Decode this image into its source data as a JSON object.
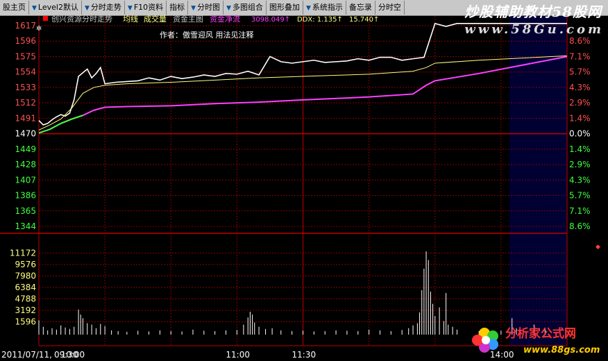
{
  "toolbar": {
    "items": [
      {
        "label": "股主页",
        "arrow": false
      },
      {
        "label": "Level2默认",
        "arrow": true
      },
      {
        "label": "分时走势",
        "arrow": true
      },
      {
        "label": "F10资料",
        "arrow": true
      },
      {
        "label": "指标",
        "arrow": false
      },
      {
        "label": "分时图",
        "arrow": true
      },
      {
        "label": "多图组合",
        "arrow": true
      },
      {
        "label": "图形叠加",
        "arrow": false
      },
      {
        "label": "系统指示",
        "arrow": true
      },
      {
        "label": "备忘录",
        "arrow": false
      },
      {
        "label": "分时空",
        "arrow": false
      }
    ]
  },
  "watermark": {
    "line1": "炒股辅助教材58股网",
    "line2": "www.58Gu.com"
  },
  "legend": {
    "stock_title": "创兴资源分时走势",
    "avg_line": "均线",
    "volume": "成交量",
    "capital_chart": "资金主图",
    "net_flow_label": "资金净流",
    "net_flow_value": "3098.049↑",
    "ddx": "DDX: 1.135↑",
    "ddx2": "15.740↑"
  },
  "author_note": "作者：傲雪迎风   用法见注释",
  "colors": {
    "up": "#ff5050",
    "down": "#40ff40",
    "price": "#ffffff",
    "avg": "#ffff80",
    "flow": "#ff40ff",
    "grid": "#8b0000",
    "axis": "#c00000"
  },
  "chart_data": {
    "type": "line",
    "date": "2011/07/11",
    "time_labels": [
      "09:30",
      "10:00",
      "11:00",
      "11:30",
      "14:00"
    ],
    "price_axis": {
      "ticks": [
        1617,
        1596,
        1575,
        1554,
        1533,
        1512,
        1491,
        1470,
        1449,
        1428,
        1407,
        1386,
        1365,
        1344
      ],
      "prev_close": 1470,
      "ylim": [
        1344,
        1617
      ]
    },
    "pct_axis": {
      "ticks": [
        "8.6%",
        "7.1%",
        "5.7%",
        "4.3%",
        "2.9%",
        "1.4%",
        "0.0%",
        "1.4%",
        "2.9%",
        "4.3%",
        "5.7%",
        "7.1%",
        "8.6%"
      ]
    },
    "volume_axis": {
      "ticks": [
        11172,
        9576,
        7980,
        6384,
        4788,
        3192,
        1596
      ],
      "ylim": [
        0,
        12768
      ]
    },
    "series": [
      {
        "name": "price",
        "x": [
          0,
          2,
          4,
          6,
          8,
          10,
          12,
          14,
          16,
          18,
          20,
          22,
          24,
          26,
          28,
          30,
          35,
          40,
          45,
          50,
          55,
          60,
          65,
          70,
          75,
          80,
          85,
          90,
          95,
          100,
          105,
          110,
          115,
          120,
          125,
          130,
          135,
          140,
          145,
          150,
          155,
          160,
          165,
          170,
          175,
          180,
          185,
          190,
          195,
          200,
          205,
          210,
          215,
          220,
          225,
          230,
          235,
          240
        ],
        "values": [
          1488,
          1482,
          1484,
          1489,
          1493,
          1496,
          1494,
          1498,
          1516,
          1548,
          1553,
          1558,
          1546,
          1552,
          1560,
          1538,
          1540,
          1541,
          1542,
          1546,
          1543,
          1548,
          1545,
          1547,
          1550,
          1548,
          1552,
          1551,
          1555,
          1550,
          1575,
          1568,
          1566,
          1568,
          1570,
          1567,
          1568,
          1569,
          1572,
          1570,
          1574,
          1574,
          1570,
          1572,
          1574,
          1620,
          1616,
          1620,
          1620,
          1620,
          1620,
          1620,
          1620,
          1620,
          1620,
          1620,
          1620,
          1620
        ]
      },
      {
        "name": "avg",
        "x": [
          0,
          5,
          10,
          15,
          20,
          25,
          30,
          40,
          60,
          80,
          100,
          120,
          150,
          170,
          176,
          180,
          200,
          240
        ],
        "values": [
          1475,
          1482,
          1490,
          1505,
          1525,
          1533,
          1536,
          1538,
          1540,
          1543,
          1546,
          1548,
          1551,
          1555,
          1560,
          1566,
          1570,
          1576
        ]
      },
      {
        "name": "flow",
        "x": [
          0,
          5,
          10,
          15,
          20,
          25,
          30,
          40,
          60,
          80,
          100,
          120,
          150,
          170,
          176,
          180,
          200,
          240
        ],
        "values": [
          1471,
          1476,
          1484,
          1490,
          1495,
          1502,
          1506,
          1507,
          1508,
          1511,
          1513,
          1516,
          1520,
          1524,
          1536,
          1542,
          1552,
          1575
        ]
      }
    ],
    "volume": [
      {
        "x": 0,
        "v": 1800
      },
      {
        "x": 2,
        "v": 900
      },
      {
        "x": 4,
        "v": 400
      },
      {
        "x": 6,
        "v": 700
      },
      {
        "x": 8,
        "v": 500
      },
      {
        "x": 10,
        "v": 1100
      },
      {
        "x": 12,
        "v": 800
      },
      {
        "x": 14,
        "v": 600
      },
      {
        "x": 16,
        "v": 900
      },
      {
        "x": 18,
        "v": 3300
      },
      {
        "x": 19,
        "v": 2600
      },
      {
        "x": 20,
        "v": 2100
      },
      {
        "x": 22,
        "v": 1400
      },
      {
        "x": 24,
        "v": 1200
      },
      {
        "x": 26,
        "v": 700
      },
      {
        "x": 28,
        "v": 1300
      },
      {
        "x": 30,
        "v": 1000
      },
      {
        "x": 33,
        "v": 400
      },
      {
        "x": 36,
        "v": 300
      },
      {
        "x": 40,
        "v": 200
      },
      {
        "x": 45,
        "v": 350
      },
      {
        "x": 50,
        "v": 250
      },
      {
        "x": 55,
        "v": 400
      },
      {
        "x": 60,
        "v": 300
      },
      {
        "x": 65,
        "v": 250
      },
      {
        "x": 70,
        "v": 500
      },
      {
        "x": 75,
        "v": 350
      },
      {
        "x": 80,
        "v": 300
      },
      {
        "x": 85,
        "v": 400
      },
      {
        "x": 90,
        "v": 450
      },
      {
        "x": 93,
        "v": 1200
      },
      {
        "x": 95,
        "v": 2200
      },
      {
        "x": 96,
        "v": 3000
      },
      {
        "x": 97,
        "v": 2600
      },
      {
        "x": 98,
        "v": 1500
      },
      {
        "x": 100,
        "v": 900
      },
      {
        "x": 103,
        "v": 600
      },
      {
        "x": 106,
        "v": 700
      },
      {
        "x": 110,
        "v": 400
      },
      {
        "x": 115,
        "v": 300
      },
      {
        "x": 120,
        "v": 350
      },
      {
        "x": 125,
        "v": 250
      },
      {
        "x": 130,
        "v": 300
      },
      {
        "x": 135,
        "v": 400
      },
      {
        "x": 140,
        "v": 350
      },
      {
        "x": 145,
        "v": 300
      },
      {
        "x": 150,
        "v": 500
      },
      {
        "x": 155,
        "v": 400
      },
      {
        "x": 160,
        "v": 300
      },
      {
        "x": 165,
        "v": 450
      },
      {
        "x": 168,
        "v": 700
      },
      {
        "x": 170,
        "v": 1100
      },
      {
        "x": 172,
        "v": 1400
      },
      {
        "x": 173,
        "v": 2900
      },
      {
        "x": 174,
        "v": 6000
      },
      {
        "x": 175,
        "v": 9000
      },
      {
        "x": 176,
        "v": 11400
      },
      {
        "x": 177,
        "v": 10200
      },
      {
        "x": 178,
        "v": 5800
      },
      {
        "x": 179,
        "v": 4100
      },
      {
        "x": 180,
        "v": 2400
      },
      {
        "x": 182,
        "v": 3600
      },
      {
        "x": 184,
        "v": 1700
      },
      {
        "x": 185,
        "v": 5600
      },
      {
        "x": 186,
        "v": 1200
      },
      {
        "x": 188,
        "v": 900
      },
      {
        "x": 190,
        "v": 500
      },
      {
        "x": 200,
        "v": 300
      },
      {
        "x": 210,
        "v": 350
      },
      {
        "x": 215,
        "v": 2100
      },
      {
        "x": 217,
        "v": 700
      },
      {
        "x": 225,
        "v": 1200
      },
      {
        "x": 230,
        "v": 600
      }
    ]
  }
}
